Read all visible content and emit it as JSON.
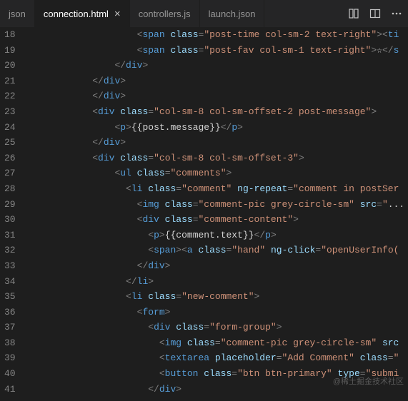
{
  "tabs": [
    {
      "label": "json"
    },
    {
      "label": "connection.html",
      "active": true
    },
    {
      "label": "controllers.js"
    },
    {
      "label": "launch.json"
    }
  ],
  "gutter_start": 18,
  "gutter_end": 41,
  "code_lines": [
    [
      {
        "indent": 10
      },
      {
        "t": "<",
        "c": "punct"
      },
      {
        "t": "span",
        "c": "tagname"
      },
      {
        "t": " "
      },
      {
        "t": "class",
        "c": "attr"
      },
      {
        "t": "=",
        "c": "punct"
      },
      {
        "t": "\"post-time col-sm-2 text-right\"",
        "c": "string"
      },
      {
        "t": "><",
        "c": "punct"
      },
      {
        "t": "ti",
        "c": "tagname"
      }
    ],
    [
      {
        "indent": 10
      },
      {
        "t": "<",
        "c": "punct"
      },
      {
        "t": "span",
        "c": "tagname"
      },
      {
        "t": " "
      },
      {
        "t": "class",
        "c": "attr"
      },
      {
        "t": "=",
        "c": "punct"
      },
      {
        "t": "\"post-fav col-sm-1 text-right\"",
        "c": "string"
      },
      {
        "t": ">",
        "c": "punct"
      },
      {
        "t": "☆",
        "c": "text"
      },
      {
        "t": "</",
        "c": "punct"
      },
      {
        "t": "s",
        "c": "tagname"
      }
    ],
    [
      {
        "indent": 8
      },
      {
        "t": "</",
        "c": "punct"
      },
      {
        "t": "div",
        "c": "tagname"
      },
      {
        "t": ">",
        "c": "punct"
      }
    ],
    [
      {
        "indent": 6
      },
      {
        "t": "</",
        "c": "punct"
      },
      {
        "t": "div",
        "c": "tagname"
      },
      {
        "t": ">",
        "c": "punct"
      }
    ],
    [
      {
        "indent": 6
      },
      {
        "t": "</",
        "c": "punct"
      },
      {
        "t": "div",
        "c": "tagname"
      },
      {
        "t": ">",
        "c": "punct"
      }
    ],
    [
      {
        "indent": 6
      },
      {
        "t": "<",
        "c": "punct"
      },
      {
        "t": "div",
        "c": "tagname"
      },
      {
        "t": " "
      },
      {
        "t": "class",
        "c": "attr"
      },
      {
        "t": "=",
        "c": "punct"
      },
      {
        "t": "\"col-sm-8 col-sm-offset-2 post-message\"",
        "c": "string"
      },
      {
        "t": ">",
        "c": "punct"
      }
    ],
    [
      {
        "indent": 8
      },
      {
        "t": "<",
        "c": "punct"
      },
      {
        "t": "p",
        "c": "tagname"
      },
      {
        "t": ">",
        "c": "punct"
      },
      {
        "t": "{{post.message}}",
        "c": "text"
      },
      {
        "t": "</",
        "c": "punct"
      },
      {
        "t": "p",
        "c": "tagname"
      },
      {
        "t": ">",
        "c": "punct"
      }
    ],
    [
      {
        "indent": 6
      },
      {
        "t": "</",
        "c": "punct"
      },
      {
        "t": "div",
        "c": "tagname"
      },
      {
        "t": ">",
        "c": "punct"
      }
    ],
    [
      {
        "indent": 6
      },
      {
        "t": "<",
        "c": "punct"
      },
      {
        "t": "div",
        "c": "tagname"
      },
      {
        "t": " "
      },
      {
        "t": "class",
        "c": "attr"
      },
      {
        "t": "=",
        "c": "punct"
      },
      {
        "t": "\"col-sm-8 col-sm-offset-3\"",
        "c": "string"
      },
      {
        "t": ">",
        "c": "punct"
      }
    ],
    [
      {
        "indent": 8
      },
      {
        "t": "<",
        "c": "punct"
      },
      {
        "t": "ul",
        "c": "tagname"
      },
      {
        "t": " "
      },
      {
        "t": "class",
        "c": "attr"
      },
      {
        "t": "=",
        "c": "punct"
      },
      {
        "t": "\"comments\"",
        "c": "string"
      },
      {
        "t": ">",
        "c": "punct"
      }
    ],
    [
      {
        "indent": 9
      },
      {
        "t": "<",
        "c": "punct"
      },
      {
        "t": "li",
        "c": "tagname"
      },
      {
        "t": " "
      },
      {
        "t": "class",
        "c": "attr"
      },
      {
        "t": "=",
        "c": "punct"
      },
      {
        "t": "\"comment\"",
        "c": "string"
      },
      {
        "t": " "
      },
      {
        "t": "ng-repeat",
        "c": "attr"
      },
      {
        "t": "=",
        "c": "punct"
      },
      {
        "t": "\"comment in postSer",
        "c": "string"
      }
    ],
    [
      {
        "indent": 10
      },
      {
        "t": "<",
        "c": "punct"
      },
      {
        "t": "img",
        "c": "tagname"
      },
      {
        "t": " "
      },
      {
        "t": "class",
        "c": "attr"
      },
      {
        "t": "=",
        "c": "punct"
      },
      {
        "t": "\"comment-pic grey-circle-sm\"",
        "c": "string"
      },
      {
        "t": " "
      },
      {
        "t": "src",
        "c": "attr"
      },
      {
        "t": "=",
        "c": "punct"
      },
      {
        "t": "\"",
        "c": "string"
      },
      {
        "t": "...",
        "c": "text"
      }
    ],
    [
      {
        "indent": 10
      },
      {
        "t": "<",
        "c": "punct"
      },
      {
        "t": "div",
        "c": "tagname"
      },
      {
        "t": " "
      },
      {
        "t": "class",
        "c": "attr"
      },
      {
        "t": "=",
        "c": "punct"
      },
      {
        "t": "\"comment-content\"",
        "c": "string"
      },
      {
        "t": ">",
        "c": "punct"
      }
    ],
    [
      {
        "indent": 11
      },
      {
        "t": "<",
        "c": "punct"
      },
      {
        "t": "p",
        "c": "tagname"
      },
      {
        "t": ">",
        "c": "punct"
      },
      {
        "t": "{{comment.text}}",
        "c": "text"
      },
      {
        "t": "</",
        "c": "punct"
      },
      {
        "t": "p",
        "c": "tagname"
      },
      {
        "t": ">",
        "c": "punct"
      }
    ],
    [
      {
        "indent": 11
      },
      {
        "t": "<",
        "c": "punct"
      },
      {
        "t": "span",
        "c": "tagname"
      },
      {
        "t": "><",
        "c": "punct"
      },
      {
        "t": "a",
        "c": "tagname"
      },
      {
        "t": " "
      },
      {
        "t": "class",
        "c": "attr"
      },
      {
        "t": "=",
        "c": "punct"
      },
      {
        "t": "\"hand\"",
        "c": "string"
      },
      {
        "t": " "
      },
      {
        "t": "ng-click",
        "c": "attr"
      },
      {
        "t": "=",
        "c": "punct"
      },
      {
        "t": "\"openUserInfo(",
        "c": "string"
      }
    ],
    [
      {
        "indent": 10
      },
      {
        "t": "</",
        "c": "punct"
      },
      {
        "t": "div",
        "c": "tagname"
      },
      {
        "t": ">",
        "c": "punct"
      }
    ],
    [
      {
        "indent": 9
      },
      {
        "t": "</",
        "c": "punct"
      },
      {
        "t": "li",
        "c": "tagname"
      },
      {
        "t": ">",
        "c": "punct"
      }
    ],
    [
      {
        "indent": 9
      },
      {
        "t": "<",
        "c": "punct"
      },
      {
        "t": "li",
        "c": "tagname"
      },
      {
        "t": " "
      },
      {
        "t": "class",
        "c": "attr"
      },
      {
        "t": "=",
        "c": "punct"
      },
      {
        "t": "\"new-comment\"",
        "c": "string"
      },
      {
        "t": ">",
        "c": "punct"
      }
    ],
    [
      {
        "indent": 10
      },
      {
        "t": "<",
        "c": "punct"
      },
      {
        "t": "form",
        "c": "tagname"
      },
      {
        "t": ">",
        "c": "punct"
      }
    ],
    [
      {
        "indent": 11
      },
      {
        "t": "<",
        "c": "punct"
      },
      {
        "t": "div",
        "c": "tagname"
      },
      {
        "t": " "
      },
      {
        "t": "class",
        "c": "attr"
      },
      {
        "t": "=",
        "c": "punct"
      },
      {
        "t": "\"form-group\"",
        "c": "string"
      },
      {
        "t": ">",
        "c": "punct"
      }
    ],
    [
      {
        "indent": 12
      },
      {
        "t": "<",
        "c": "punct"
      },
      {
        "t": "img",
        "c": "tagname"
      },
      {
        "t": " "
      },
      {
        "t": "class",
        "c": "attr"
      },
      {
        "t": "=",
        "c": "punct"
      },
      {
        "t": "\"comment-pic grey-circle-sm\"",
        "c": "string"
      },
      {
        "t": " "
      },
      {
        "t": "src",
        "c": "attr"
      }
    ],
    [
      {
        "indent": 12
      },
      {
        "t": "<",
        "c": "punct"
      },
      {
        "t": "textarea",
        "c": "tagname"
      },
      {
        "t": " "
      },
      {
        "t": "placeholder",
        "c": "attr"
      },
      {
        "t": "=",
        "c": "punct"
      },
      {
        "t": "\"Add Comment\"",
        "c": "string"
      },
      {
        "t": " "
      },
      {
        "t": "class",
        "c": "attr"
      },
      {
        "t": "=",
        "c": "punct"
      },
      {
        "t": "\"",
        "c": "string"
      }
    ],
    [
      {
        "indent": 12
      },
      {
        "t": "<",
        "c": "punct"
      },
      {
        "t": "button",
        "c": "tagname"
      },
      {
        "t": " "
      },
      {
        "t": "class",
        "c": "attr"
      },
      {
        "t": "=",
        "c": "punct"
      },
      {
        "t": "\"btn btn-primary\"",
        "c": "string"
      },
      {
        "t": " "
      },
      {
        "t": "type",
        "c": "attr"
      },
      {
        "t": "=",
        "c": "punct"
      },
      {
        "t": "\"submi",
        "c": "string"
      }
    ],
    [
      {
        "indent": 11
      },
      {
        "t": "</",
        "c": "punct"
      },
      {
        "t": "div",
        "c": "tagname"
      },
      {
        "t": ">",
        "c": "punct"
      }
    ]
  ],
  "watermark": "@稀土掘金技术社区"
}
